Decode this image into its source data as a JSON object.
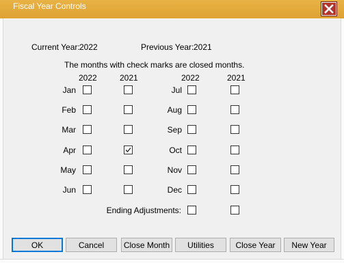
{
  "window": {
    "title": "Fiscal Year Controls"
  },
  "header": {
    "current_year_label": "Current Year:",
    "current_year_value": "2022",
    "previous_year_label": "Previous Year:",
    "previous_year_value": "2021",
    "instructions": "The months with check marks are closed months."
  },
  "columns": {
    "left_current": "2022",
    "left_previous": "2021",
    "right_current": "2022",
    "right_previous": "2021"
  },
  "months_left": [
    {
      "label": "Jan",
      "current_closed": false,
      "previous_closed": false
    },
    {
      "label": "Feb",
      "current_closed": false,
      "previous_closed": false
    },
    {
      "label": "Mar",
      "current_closed": false,
      "previous_closed": false
    },
    {
      "label": "Apr",
      "current_closed": false,
      "previous_closed": true
    },
    {
      "label": "May",
      "current_closed": false,
      "previous_closed": false
    },
    {
      "label": "Jun",
      "current_closed": false,
      "previous_closed": false
    }
  ],
  "months_right": [
    {
      "label": "Jul",
      "current_closed": false,
      "previous_closed": false
    },
    {
      "label": "Aug",
      "current_closed": false,
      "previous_closed": false
    },
    {
      "label": "Sep",
      "current_closed": false,
      "previous_closed": false
    },
    {
      "label": "Oct",
      "current_closed": false,
      "previous_closed": false
    },
    {
      "label": "Nov",
      "current_closed": false,
      "previous_closed": false
    },
    {
      "label": "Dec",
      "current_closed": false,
      "previous_closed": false
    }
  ],
  "ending_adjustments": {
    "label": "Ending Adjustments:",
    "current_closed": false,
    "previous_closed": false
  },
  "buttons": {
    "ok": "OK",
    "cancel": "Cancel",
    "close_month": "Close Month",
    "utilities": "Utilities",
    "close_year": "Close Year",
    "new_year": "New Year"
  },
  "colors": {
    "titlebar": "#e3a93a",
    "close_button": "#b3352a",
    "dialog_background": "#f0f0f0",
    "default_button_border": "#0078d7"
  },
  "icons": {
    "close": "close-x-icon",
    "check": "check-mark-icon"
  }
}
